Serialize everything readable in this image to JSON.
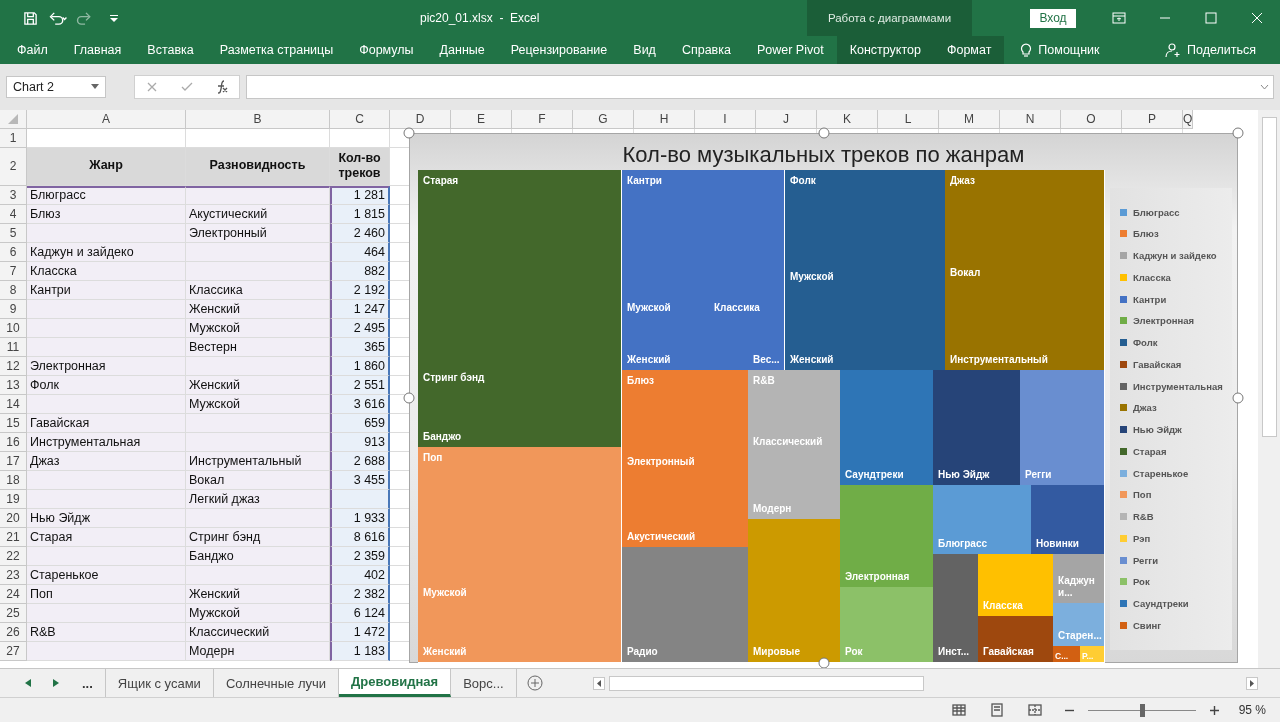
{
  "window": {
    "title": "pic20_01.xlsx  -  Excel",
    "context_group": "Работа с диаграммами",
    "signin": "Вход"
  },
  "ribbon_tabs": [
    {
      "label": "Файл",
      "kind": "normal"
    },
    {
      "label": "Главная",
      "kind": "normal"
    },
    {
      "label": "Вставка",
      "kind": "normal"
    },
    {
      "label": "Разметка страницы",
      "kind": "normal"
    },
    {
      "label": "Формулы",
      "kind": "normal"
    },
    {
      "label": "Данные",
      "kind": "normal"
    },
    {
      "label": "Рецензирование",
      "kind": "normal"
    },
    {
      "label": "Вид",
      "kind": "normal"
    },
    {
      "label": "Справка",
      "kind": "normal"
    },
    {
      "label": "Power Pivot",
      "kind": "normal"
    },
    {
      "label": "Конструктор",
      "kind": "contextual"
    },
    {
      "label": "Формат",
      "kind": "contextual"
    }
  ],
  "assistant": "Помощник",
  "share": "Поделиться",
  "name_box": "Chart 2",
  "columns": [
    "A",
    "B",
    "C",
    "D",
    "E",
    "F",
    "G",
    "H",
    "I",
    "J",
    "K",
    "L",
    "M",
    "N",
    "O",
    "P",
    "Q"
  ],
  "rows": [
    {
      "n": "1",
      "kind": "blank"
    },
    {
      "n": "2",
      "kind": "header",
      "a": "Жанр",
      "b": "Разновидность",
      "c": "Кол-во треков"
    },
    {
      "n": "3",
      "kind": "data",
      "a": "Блюграсс",
      "c": "1 281"
    },
    {
      "n": "4",
      "kind": "data",
      "a": "Блюз",
      "b": "Акустический",
      "c": "1 815"
    },
    {
      "n": "5",
      "kind": "data",
      "b": "Электронный",
      "c": "2 460"
    },
    {
      "n": "6",
      "kind": "data",
      "a": "Каджун и зайдеко",
      "c": "464"
    },
    {
      "n": "7",
      "kind": "data",
      "a": "Класска",
      "c": "882"
    },
    {
      "n": "8",
      "kind": "data",
      "a": "Кантри",
      "b": "Классика",
      "c": "2 192"
    },
    {
      "n": "9",
      "kind": "data",
      "b": "Женский",
      "c": "1 247"
    },
    {
      "n": "10",
      "kind": "data",
      "b": "Мужской",
      "c": "2 495"
    },
    {
      "n": "11",
      "kind": "data",
      "b": "Вестерн",
      "c": "365"
    },
    {
      "n": "12",
      "kind": "data",
      "a": "Электронная",
      "c": "1 860"
    },
    {
      "n": "13",
      "kind": "data",
      "a": "Фолк",
      "b": "Женский",
      "c": "2 551"
    },
    {
      "n": "14",
      "kind": "data",
      "b": "Мужской",
      "c": "3 616"
    },
    {
      "n": "15",
      "kind": "data",
      "a": "Гавайская",
      "c": "659"
    },
    {
      "n": "16",
      "kind": "data",
      "a": "Инструментальная",
      "c": "913"
    },
    {
      "n": "17",
      "kind": "data",
      "a": "Джаз",
      "b": "Инструментальный",
      "c": "2 688"
    },
    {
      "n": "18",
      "kind": "data",
      "b": "Вокал",
      "c": "3 455"
    },
    {
      "n": "19",
      "kind": "data",
      "b": "Легкий джаз"
    },
    {
      "n": "20",
      "kind": "data",
      "a": "Нью Эйдж",
      "c": "1 933"
    },
    {
      "n": "21",
      "kind": "data",
      "a": "Старая",
      "b": "Стринг бэнд",
      "c": "8 616"
    },
    {
      "n": "22",
      "kind": "data",
      "b": "Банджо",
      "c": "2 359"
    },
    {
      "n": "23",
      "kind": "data",
      "a": "Старенькое",
      "c": "402"
    },
    {
      "n": "24",
      "kind": "data",
      "a": "Поп",
      "b": "Женский",
      "c": "2 382"
    },
    {
      "n": "25",
      "kind": "data",
      "b": "Мужской",
      "c": "6 124"
    },
    {
      "n": "26",
      "kind": "data",
      "a": "R&B",
      "b": "Классический",
      "c": "1 472"
    },
    {
      "n": "27",
      "kind": "data",
      "b": "Модерн",
      "c": "1 183"
    }
  ],
  "chart": {
    "title": "Кол-во музыкальных треков по жанрам",
    "tiles": [
      {
        "group": "Старая",
        "label": "Стринг бэнд",
        "color": "#43682b"
      },
      {
        "label": "Банджо",
        "color": "#43682b"
      },
      {
        "group": "Поп",
        "label": "Мужской",
        "color": "#f1975a"
      },
      {
        "label": "Женский",
        "color": "#f1975a"
      },
      {
        "group": "Кантри",
        "label": "Мужской",
        "color": "#4472c4"
      },
      {
        "label": "Классика",
        "color": "#4472c4"
      },
      {
        "label": "Женский",
        "color": "#4472c4"
      },
      {
        "label": "Вес...",
        "color": "#4472c4"
      },
      {
        "group": "Фолк",
        "label": "Мужской",
        "color": "#255e91"
      },
      {
        "label": "Женский",
        "color": "#255e91"
      },
      {
        "group": "Джаз",
        "label": "Вокал",
        "color": "#997300"
      },
      {
        "label": "Инструментальный",
        "color": "#997300"
      },
      {
        "group": "Блюз",
        "label": "Электронный",
        "color": "#ed7d31"
      },
      {
        "label": "Акустический",
        "color": "#ed7d31"
      },
      {
        "label": "Радио",
        "color": "#848484"
      },
      {
        "group": "R&B",
        "label": "Классический",
        "color": "#b4b4b4"
      },
      {
        "label": "Модерн",
        "color": "#b4b4b4"
      },
      {
        "label": "Мировые",
        "color": "#cc9a00"
      },
      {
        "label": "Саундтреки",
        "color": "#2e75b6"
      },
      {
        "label": "Нью Эйдж",
        "color": "#264478"
      },
      {
        "label": "Регги",
        "color": "#698ed0"
      },
      {
        "label": "Электронная",
        "color": "#70ad47"
      },
      {
        "label": "Рок",
        "color": "#8cc168"
      },
      {
        "label": "Блюграсс",
        "color": "#5b9bd5"
      },
      {
        "label": "Новинки",
        "color": "#335aa1"
      },
      {
        "label": "Инст...",
        "color": "#636363"
      },
      {
        "label": "Класска",
        "color": "#ffc000"
      },
      {
        "label": "Гавайская",
        "color": "#9e480e"
      },
      {
        "label": "Каджун и...",
        "color": "#a5a5a5"
      },
      {
        "label": "Старен...",
        "color": "#7cafdd"
      },
      {
        "label": "С...",
        "color": "#d26012"
      },
      {
        "label": "Р...",
        "color": "#ffcd33"
      }
    ],
    "legend": [
      {
        "label": "Блюграсс",
        "color": "#5b9bd5"
      },
      {
        "label": "Блюз",
        "color": "#ed7d31"
      },
      {
        "label": "Каджун и зайдеко",
        "color": "#a5a5a5"
      },
      {
        "label": "Класска",
        "color": "#ffc000"
      },
      {
        "label": "Кантри",
        "color": "#4472c4"
      },
      {
        "label": "Электронная",
        "color": "#70ad47"
      },
      {
        "label": "Фолк",
        "color": "#255e91"
      },
      {
        "label": "Гавайская",
        "color": "#9e480e"
      },
      {
        "label": "Инструментальная",
        "color": "#636363"
      },
      {
        "label": "Джаз",
        "color": "#997300"
      },
      {
        "label": "Нью Эйдж",
        "color": "#264478"
      },
      {
        "label": "Старая",
        "color": "#43682b"
      },
      {
        "label": "Старенькое",
        "color": "#7cafdd"
      },
      {
        "label": "Поп",
        "color": "#f1975a"
      },
      {
        "label": "R&B",
        "color": "#b4b4b4"
      },
      {
        "label": "Рэп",
        "color": "#ffcd33"
      },
      {
        "label": "Регги",
        "color": "#698ed0"
      },
      {
        "label": "Рок",
        "color": "#8cc168"
      },
      {
        "label": "Саундтреки",
        "color": "#2e75b6"
      },
      {
        "label": "Свинг",
        "color": "#d26012"
      }
    ]
  },
  "sheet_nav": "...",
  "sheet_tabs": [
    {
      "label": "Ящик с усами",
      "selected": false
    },
    {
      "label": "Солнечные лучи",
      "selected": false
    },
    {
      "label": "Древовидная",
      "selected": true
    },
    {
      "label": "Ворс...",
      "selected": false
    }
  ],
  "zoom": {
    "label": "95 %",
    "level": 0.5
  }
}
